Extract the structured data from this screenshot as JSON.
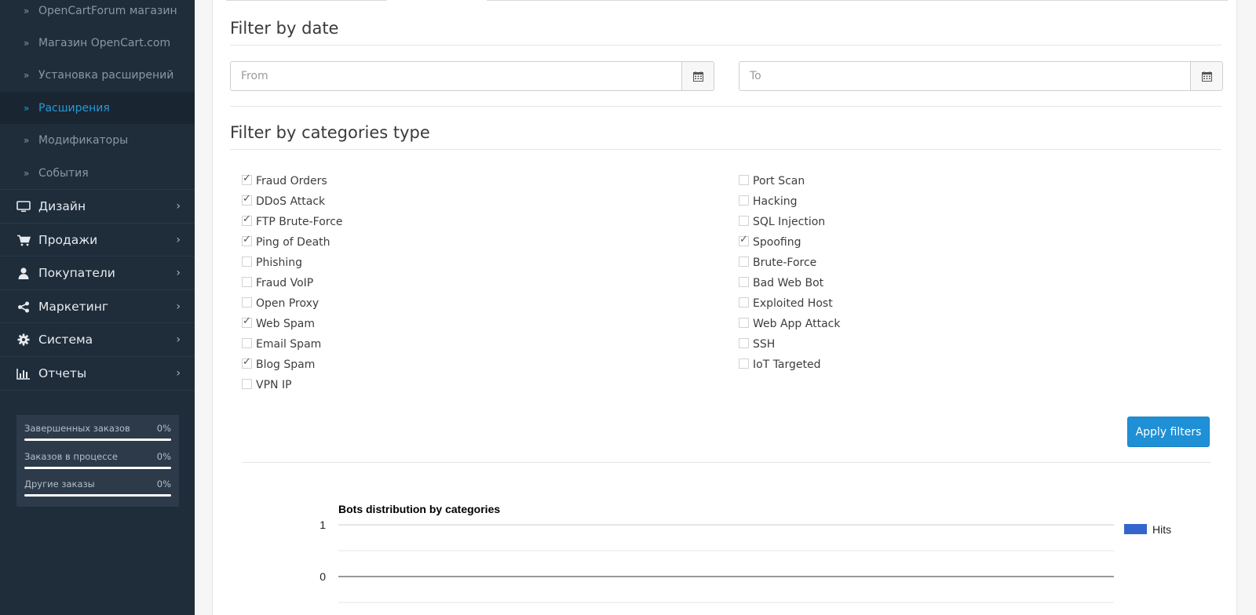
{
  "sidebar": {
    "sub_items": [
      {
        "label": "OpenCartForum магазин",
        "active": false
      },
      {
        "label": "Магазин OpenCart.com",
        "active": false
      },
      {
        "label": "Установка расширений",
        "active": false
      },
      {
        "label": "Расширения",
        "active": true
      },
      {
        "label": "Модификаторы",
        "active": false
      },
      {
        "label": "События",
        "active": false
      }
    ],
    "main_items": [
      {
        "label": "Дизайн",
        "icon": "monitor-icon"
      },
      {
        "label": "Продажи",
        "icon": "cart-icon"
      },
      {
        "label": "Покупатели",
        "icon": "user-icon"
      },
      {
        "label": "Маркетинг",
        "icon": "share-icon"
      },
      {
        "label": "Система",
        "icon": "gear-icon"
      },
      {
        "label": "Отчеты",
        "icon": "bar-chart-icon"
      }
    ],
    "stats": [
      {
        "label": "Завершенных заказов",
        "value": "0%",
        "progress": 0
      },
      {
        "label": "Заказов в процессе",
        "value": "0%",
        "progress": 0
      },
      {
        "label": "Другие заказы",
        "value": "0%",
        "progress": 0
      }
    ]
  },
  "filter_date": {
    "title": "Filter by date",
    "from_placeholder": "From",
    "to_placeholder": "To"
  },
  "filter_categories": {
    "title": "Filter by categories type",
    "left": [
      {
        "label": "Fraud Orders",
        "checked": true
      },
      {
        "label": "DDoS Attack",
        "checked": true
      },
      {
        "label": "FTP Brute-Force",
        "checked": true
      },
      {
        "label": "Ping of Death",
        "checked": true
      },
      {
        "label": "Phishing",
        "checked": false
      },
      {
        "label": "Fraud VoIP",
        "checked": false
      },
      {
        "label": "Open Proxy",
        "checked": false
      },
      {
        "label": "Web Spam",
        "checked": true
      },
      {
        "label": "Email Spam",
        "checked": false
      },
      {
        "label": "Blog Spam",
        "checked": true
      },
      {
        "label": "VPN IP",
        "checked": false
      }
    ],
    "right": [
      {
        "label": "Port Scan",
        "checked": false
      },
      {
        "label": "Hacking",
        "checked": false
      },
      {
        "label": "SQL Injection",
        "checked": false
      },
      {
        "label": "Spoofing",
        "checked": true
      },
      {
        "label": "Brute-Force",
        "checked": false
      },
      {
        "label": "Bad Web Bot",
        "checked": false
      },
      {
        "label": "Exploited Host",
        "checked": false
      },
      {
        "label": "Web App Attack",
        "checked": false
      },
      {
        "label": "SSH",
        "checked": false
      },
      {
        "label": "IoT Targeted",
        "checked": false
      }
    ],
    "apply_label": "Apply filters"
  },
  "colors": {
    "sidebar_bg": "#1f2c3a",
    "accent": "#229ad6",
    "button": "#1f90d6",
    "series": "#3366cc"
  },
  "chart_data": {
    "type": "bar",
    "title": "Bots distribution by categories",
    "categories": [],
    "series": [
      {
        "name": "Hits",
        "values": []
      }
    ],
    "ylim": [
      0,
      1
    ],
    "yticks": [
      1,
      0
    ],
    "legend": "right",
    "grid": true
  }
}
